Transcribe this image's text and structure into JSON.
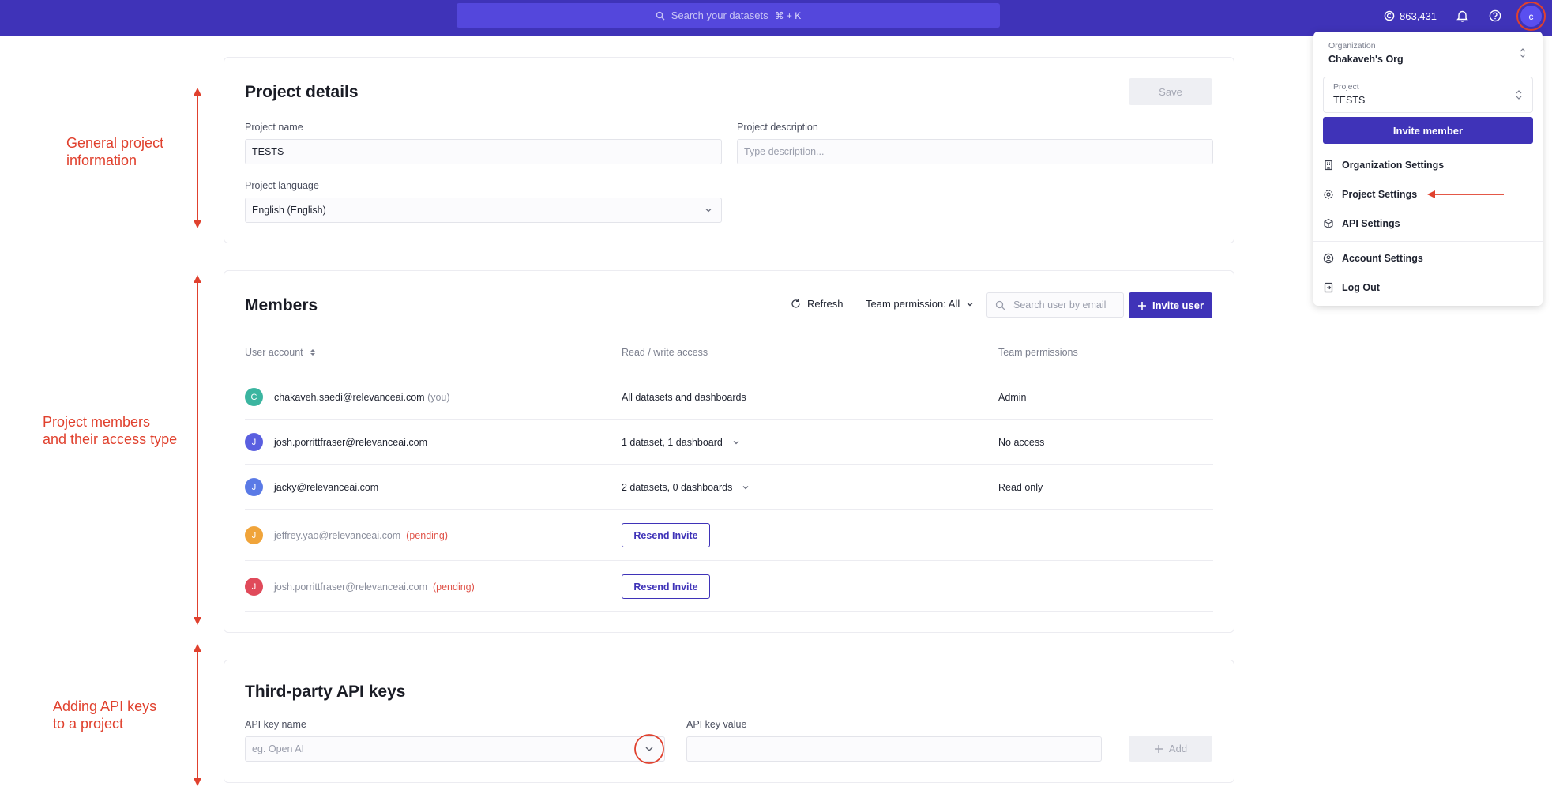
{
  "topbar": {
    "search_placeholder": "Search your datasets",
    "search_shortcut": "⌘ + K",
    "credits": "863,431",
    "avatar_initial": "c"
  },
  "project_details": {
    "title": "Project details",
    "save_label": "Save",
    "name_label": "Project name",
    "name_value": "TESTS",
    "description_label": "Project description",
    "description_placeholder": "Type description...",
    "language_label": "Project language",
    "language_value": "English (English)"
  },
  "members": {
    "title": "Members",
    "refresh_label": "Refresh",
    "team_permission_label": "Team permission: All",
    "search_placeholder": "Search user by email",
    "invite_label": "Invite user",
    "columns": [
      "User account",
      "Read / write access",
      "Team permissions"
    ],
    "rows": [
      {
        "initial": "C",
        "color": "#3bb5a0",
        "email": "chakaveh.saedi@relevanceai.com",
        "tag": "(you)",
        "access": "All datasets and dashboards",
        "access_dropdown": false,
        "permission": "Admin",
        "pending": false
      },
      {
        "initial": "J",
        "color": "#5a5fe0",
        "email": "josh.porrittfraser@relevanceai.com",
        "tag": "",
        "access": "1 dataset, 1 dashboard",
        "access_dropdown": true,
        "permission": "No access",
        "pending": false
      },
      {
        "initial": "J",
        "color": "#5a7ae6",
        "email": "jacky@relevanceai.com",
        "tag": "",
        "access": "2 datasets, 0 dashboards",
        "access_dropdown": true,
        "permission": "Read only",
        "pending": false
      },
      {
        "initial": "J",
        "color": "#f0a43a",
        "email": "jeffrey.yao@relevanceai.com",
        "tag": "(pending)",
        "access": "Resend Invite",
        "access_dropdown": false,
        "permission": "",
        "pending": true
      },
      {
        "initial": "J",
        "color": "#e04a5a",
        "email": "josh.porrittfraser@relevanceai.com",
        "tag": "(pending)",
        "access": "Resend Invite",
        "access_dropdown": false,
        "permission": "",
        "pending": true
      }
    ]
  },
  "api_keys": {
    "title": "Third-party API keys",
    "name_label": "API key name",
    "name_placeholder": "eg. Open AI",
    "value_label": "API key value",
    "add_label": "Add"
  },
  "annotations": {
    "general": "General project\ninformation",
    "members": "Project members\nand their access type",
    "api": "Adding API keys\nto a project"
  },
  "menu": {
    "org_label": "Organization",
    "org_value": "Chakaveh's Org",
    "project_label": "Project",
    "project_value": "TESTS",
    "invite_label": "Invite member",
    "items": [
      "Organization Settings",
      "Project Settings",
      "API Settings",
      "Account Settings",
      "Log Out"
    ]
  },
  "colors": {
    "brand": "#3f33b8",
    "annotation": "#e0412e"
  }
}
